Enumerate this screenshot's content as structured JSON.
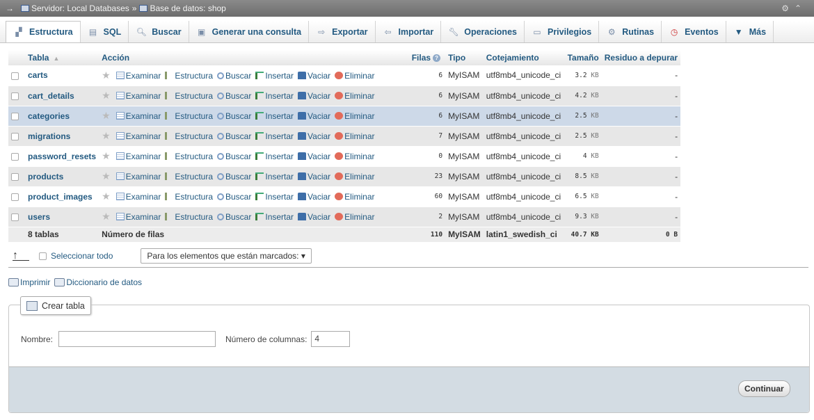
{
  "breadcrumb": {
    "server": "Servidor: Local Databases",
    "separator": "»",
    "database": "Base de datos: shop"
  },
  "tabs": [
    {
      "label": "Estructura",
      "icon": "structure-icon",
      "active": true
    },
    {
      "label": "SQL",
      "icon": "sql-icon"
    },
    {
      "label": "Buscar",
      "icon": "search-icon"
    },
    {
      "label": "Generar una consulta",
      "icon": "query-icon"
    },
    {
      "label": "Exportar",
      "icon": "export-icon"
    },
    {
      "label": "Importar",
      "icon": "import-icon"
    },
    {
      "label": "Operaciones",
      "icon": "wrench-icon"
    },
    {
      "label": "Privilegios",
      "icon": "privileges-icon"
    },
    {
      "label": "Rutinas",
      "icon": "gears-icon"
    },
    {
      "label": "Eventos",
      "icon": "clock-icon"
    },
    {
      "label": "Más",
      "icon": "caret-down-icon"
    }
  ],
  "table": {
    "headers": {
      "tabla": "Tabla",
      "accion": "Acción",
      "filas": "Filas",
      "tipo": "Tipo",
      "cotejamiento": "Cotejamiento",
      "tamano": "Tamaño",
      "residuo": "Residuo a depurar"
    },
    "actions": {
      "examinar": "Examinar",
      "estructura": "Estructura",
      "buscar": "Buscar",
      "insertar": "Insertar",
      "vaciar": "Vaciar",
      "eliminar": "Eliminar"
    },
    "rows": [
      {
        "name": "carts",
        "rows": "6",
        "type": "MyISAM",
        "collation": "utf8mb4_unicode_ci",
        "size": "3.2",
        "unit": "KB",
        "overhead": "-"
      },
      {
        "name": "cart_details",
        "rows": "6",
        "type": "MyISAM",
        "collation": "utf8mb4_unicode_ci",
        "size": "4.2",
        "unit": "KB",
        "overhead": "-"
      },
      {
        "name": "categories",
        "rows": "6",
        "type": "MyISAM",
        "collation": "utf8mb4_unicode_ci",
        "size": "2.5",
        "unit": "KB",
        "overhead": "-"
      },
      {
        "name": "migrations",
        "rows": "7",
        "type": "MyISAM",
        "collation": "utf8mb4_unicode_ci",
        "size": "2.5",
        "unit": "KB",
        "overhead": "-"
      },
      {
        "name": "password_resets",
        "rows": "0",
        "type": "MyISAM",
        "collation": "utf8mb4_unicode_ci",
        "size": "4",
        "unit": "KB",
        "overhead": "-"
      },
      {
        "name": "products",
        "rows": "23",
        "type": "MyISAM",
        "collation": "utf8mb4_unicode_ci",
        "size": "8.5",
        "unit": "KB",
        "overhead": "-"
      },
      {
        "name": "product_images",
        "rows": "60",
        "type": "MyISAM",
        "collation": "utf8mb4_unicode_ci",
        "size": "6.5",
        "unit": "KB",
        "overhead": "-"
      },
      {
        "name": "users",
        "rows": "2",
        "type": "MyISAM",
        "collation": "utf8mb4_unicode_ci",
        "size": "9.3",
        "unit": "KB",
        "overhead": "-"
      }
    ],
    "footer": {
      "count": "8 tablas",
      "label": "Número de filas",
      "rows": "110",
      "type": "MyISAM",
      "collation": "latin1_swedish_ci",
      "size": "40.7",
      "unit": "KB",
      "overhead": "0 B"
    }
  },
  "bulk": {
    "select_all": "Seleccionar todo",
    "with_selected": "Para los elementos que están marcados:"
  },
  "links": {
    "print": "Imprimir",
    "dictionary": "Diccionario de datos"
  },
  "create": {
    "legend": "Crear tabla",
    "name_label": "Nombre:",
    "name_value": "",
    "columns_label": "Número de columnas:",
    "columns_value": "4",
    "submit": "Continuar"
  }
}
